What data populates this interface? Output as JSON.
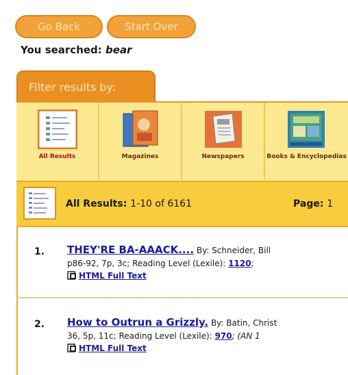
{
  "nav": {
    "go_back": "Go Back",
    "start_over": "Start Over"
  },
  "search": {
    "label": "You searched:",
    "term": "bear"
  },
  "filter": {
    "heading": "Filter results by:",
    "tabs": [
      {
        "label": "All Results",
        "icon": "list-icon"
      },
      {
        "label": "Magazines",
        "icon": "magazine-icon"
      },
      {
        "label": "Newspapers",
        "icon": "newspaper-icon"
      },
      {
        "label": "Books & Encyclopedias",
        "icon": "books-icon"
      }
    ]
  },
  "results_bar": {
    "label": "All Results:",
    "range": "1-10 of 6161",
    "page_label": "Page:",
    "page_value": "1"
  },
  "results": [
    {
      "num": "1.",
      "title": "THEY'RE BA-AAACK....",
      "byline": "By: Schneider, Bill",
      "details": "p86-92, 7p, 3c; Reading Level (Lexile):",
      "lexile": "1120",
      "details_tail": ";",
      "link": "HTML Full Text"
    },
    {
      "num": "2.",
      "title": "How to Outrun a Grizzly.",
      "byline": "By: Batin, Christ",
      "details": "36, 5p, 11c; Reading Level (Lexile):",
      "lexile": "970",
      "details_tail": "; (AN 1",
      "link": "HTML Full Text"
    }
  ],
  "colors": {
    "button_orange": "#f1a33a",
    "filter_tab_orange": "#eb8f22",
    "tabs_background": "#fbe890",
    "results_bar_yellow": "#f7cc3e",
    "link_blue": "#1a1a9a"
  }
}
